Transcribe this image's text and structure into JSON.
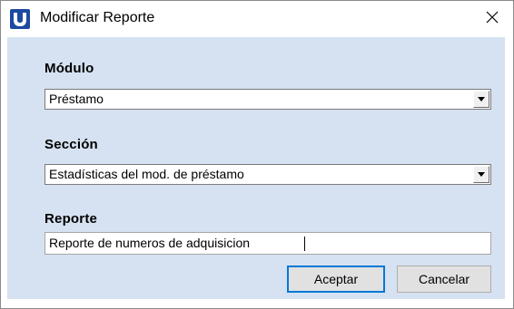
{
  "window": {
    "title": "Modificar Reporte",
    "icon": "app-logo-icon",
    "close_icon": "close-icon",
    "accent": "#1c4aa1",
    "client_bg": "#d6e2f1"
  },
  "form": {
    "modulo": {
      "label": "Módulo",
      "value": "Préstamo"
    },
    "seccion": {
      "label": "Sección",
      "value": "Estadísticas del mod. de préstamo"
    },
    "reporte": {
      "label": "Reporte",
      "value": "Reporte de numeros de adquisicion"
    }
  },
  "buttons": {
    "accept_label": "Aceptar",
    "cancel_label": "Cancelar"
  }
}
